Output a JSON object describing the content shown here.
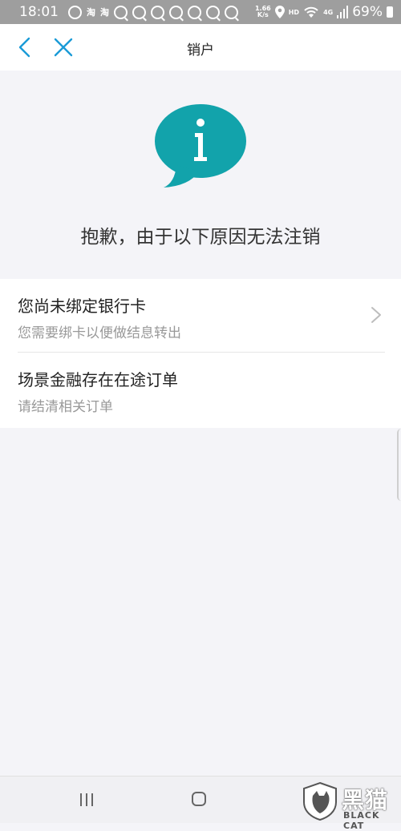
{
  "status_bar": {
    "time": "18:01",
    "net_speed_top": "1.66",
    "net_speed_bottom": "K/s",
    "hd": "HD",
    "signal": "4G",
    "battery": "69%"
  },
  "header": {
    "title": "销户"
  },
  "info": {
    "headline": "抱歉，由于以下原因无法注销",
    "icon_color": "#12a3ab"
  },
  "reasons": [
    {
      "title": "您尚未绑定银行卡",
      "subtitle": "您需要绑卡以便做结息转出"
    },
    {
      "title": "场景金融存在在途订单",
      "subtitle": "请结清相关订单"
    }
  ],
  "colors": {
    "accent": "#1a9bd7",
    "background": "#f4f4f8"
  },
  "watermark": {
    "name": "黑猫",
    "sub": "BLACK CAT"
  }
}
